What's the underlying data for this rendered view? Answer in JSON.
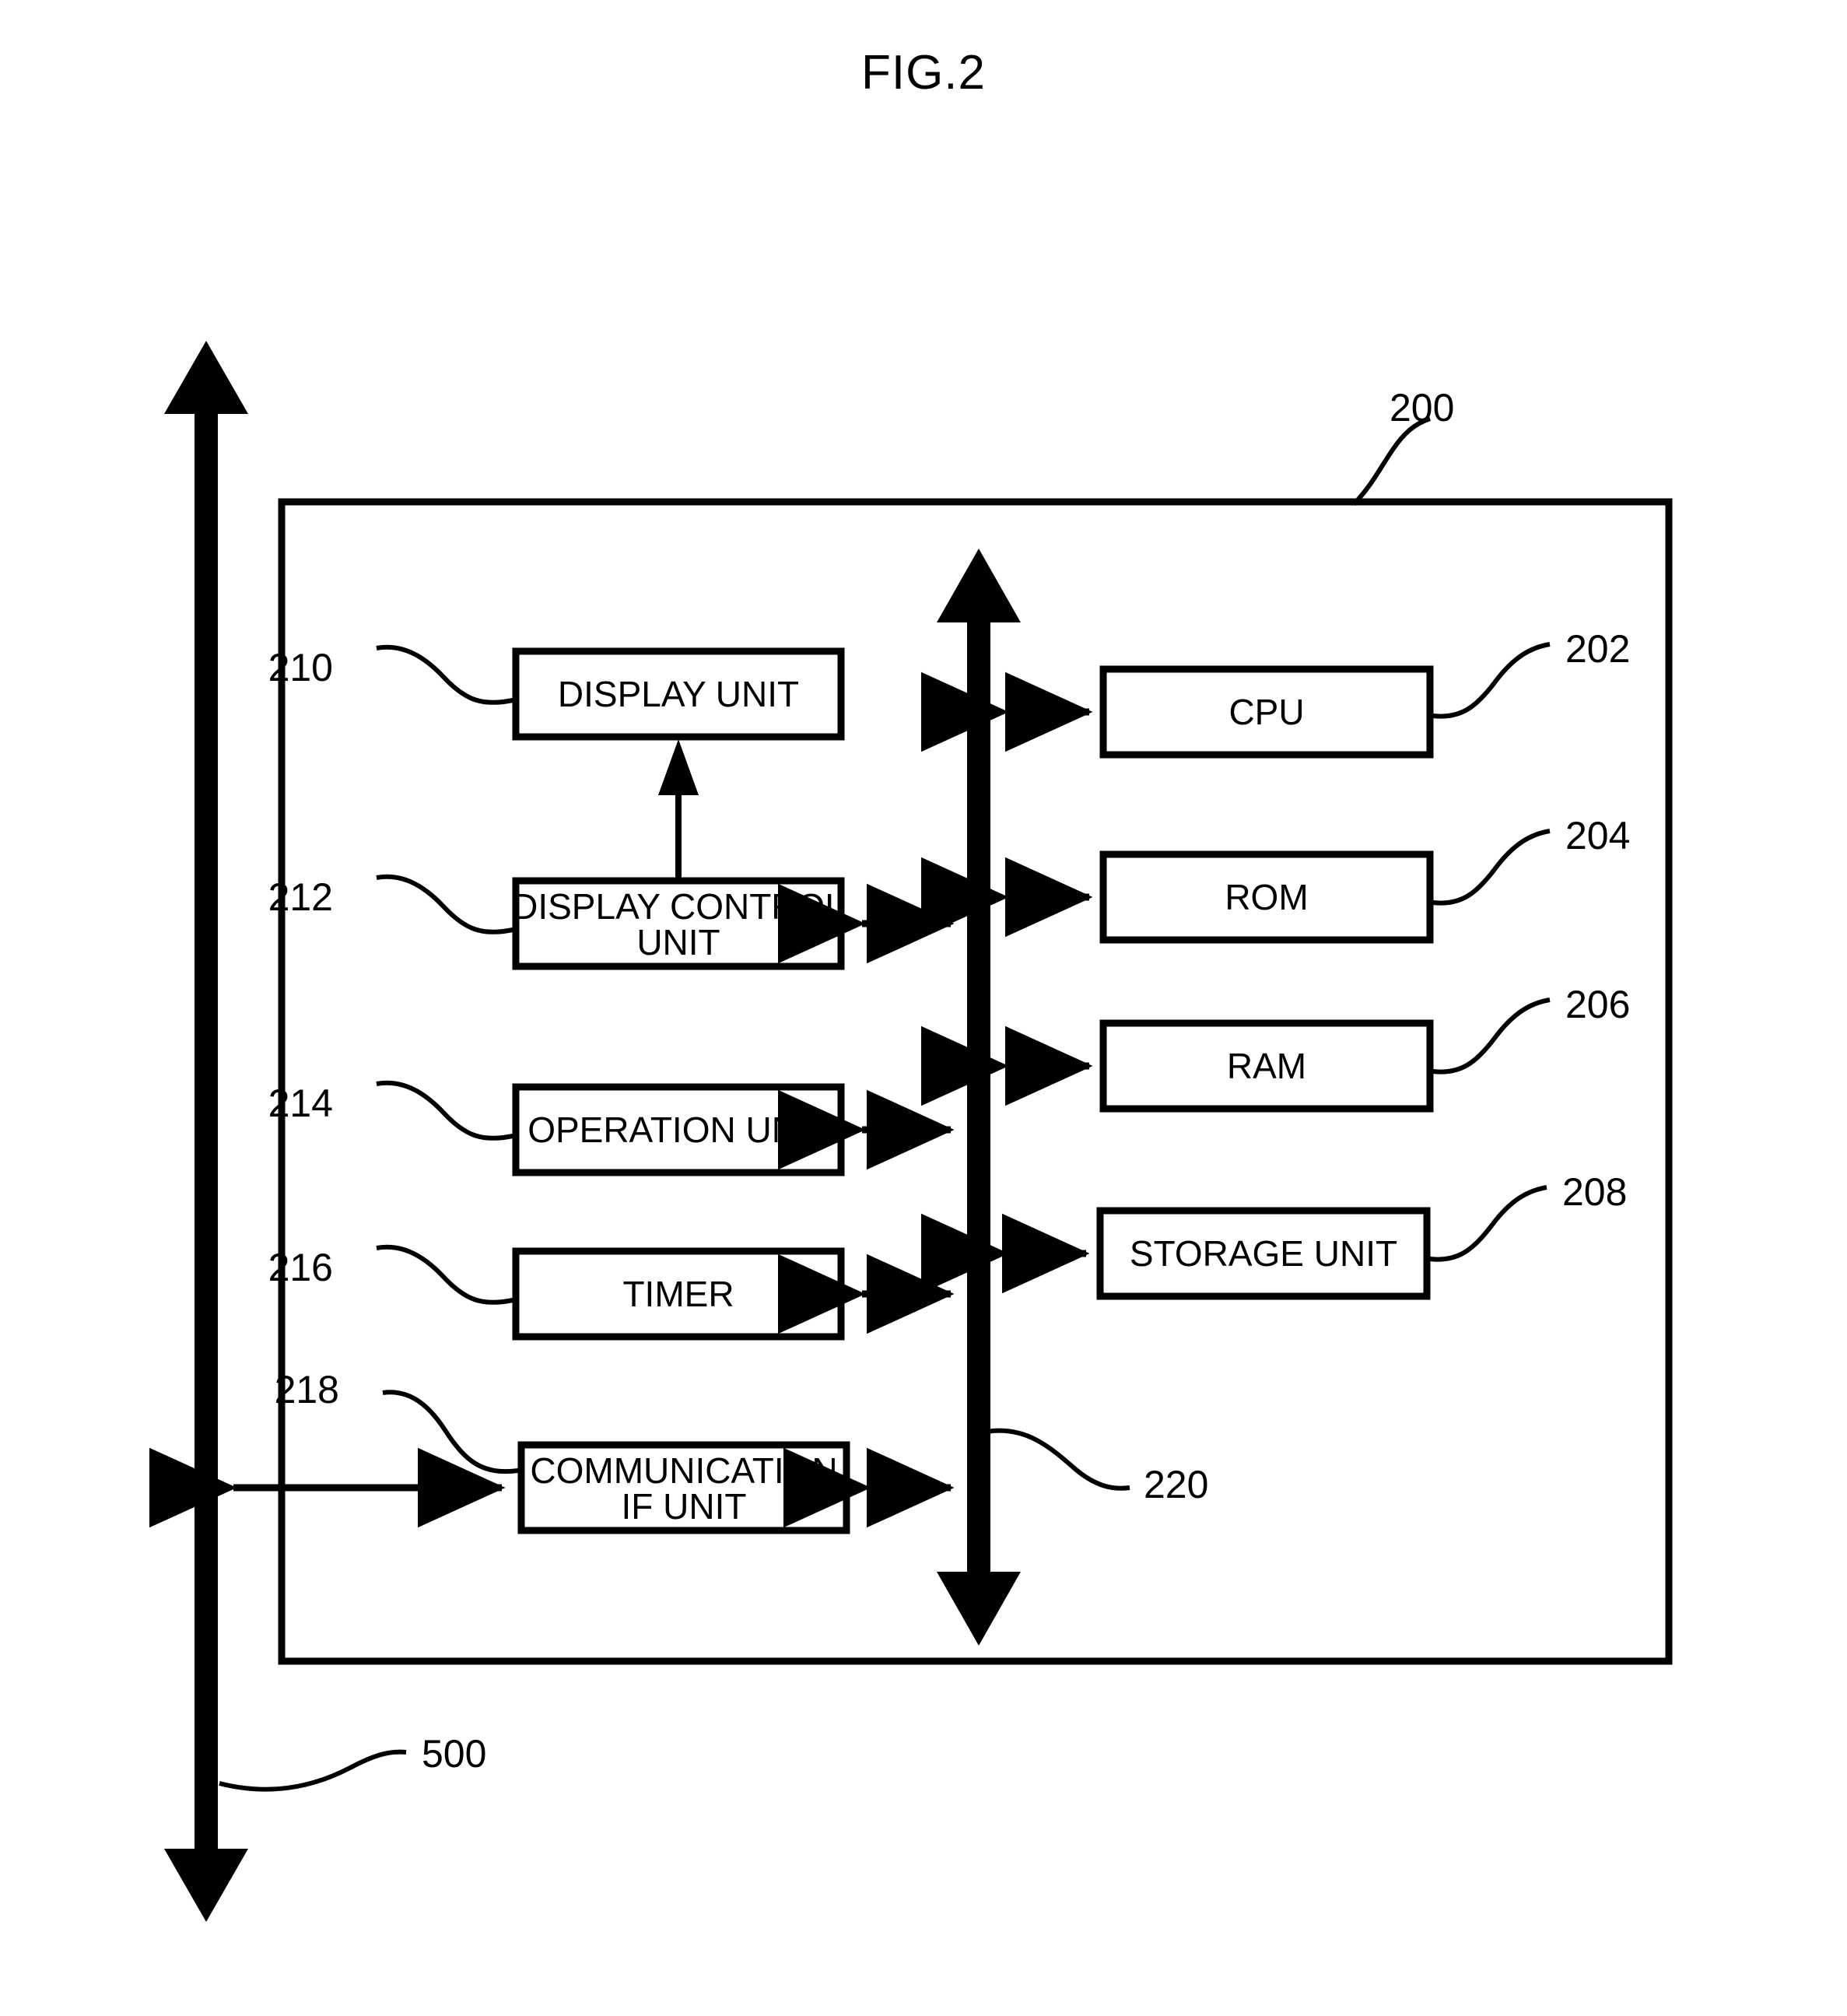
{
  "figure": {
    "title": "FIG.2",
    "device_ref": "200",
    "bus_ref": "220",
    "network_ref": "500"
  },
  "left_column": {
    "blocks": [
      {
        "ref": "210",
        "label_line1": "DISPLAY UNIT",
        "label_line2": ""
      },
      {
        "ref": "212",
        "label_line1": "DISPLAY CONTROL",
        "label_line2": "UNIT"
      },
      {
        "ref": "214",
        "label_line1": "OPERATION UNIT",
        "label_line2": ""
      },
      {
        "ref": "216",
        "label_line1": "TIMER",
        "label_line2": ""
      },
      {
        "ref": "218",
        "label_line1": "COMMUNICATION",
        "label_line2": "IF UNIT"
      }
    ]
  },
  "right_column": {
    "blocks": [
      {
        "ref": "202",
        "label_line1": "CPU",
        "label_line2": ""
      },
      {
        "ref": "204",
        "label_line1": "ROM",
        "label_line2": ""
      },
      {
        "ref": "206",
        "label_line1": "RAM",
        "label_line2": ""
      },
      {
        "ref": "208",
        "label_line1": "STORAGE UNIT",
        "label_line2": ""
      }
    ]
  },
  "colors": {
    "stroke": "#000000",
    "background": "#ffffff"
  }
}
